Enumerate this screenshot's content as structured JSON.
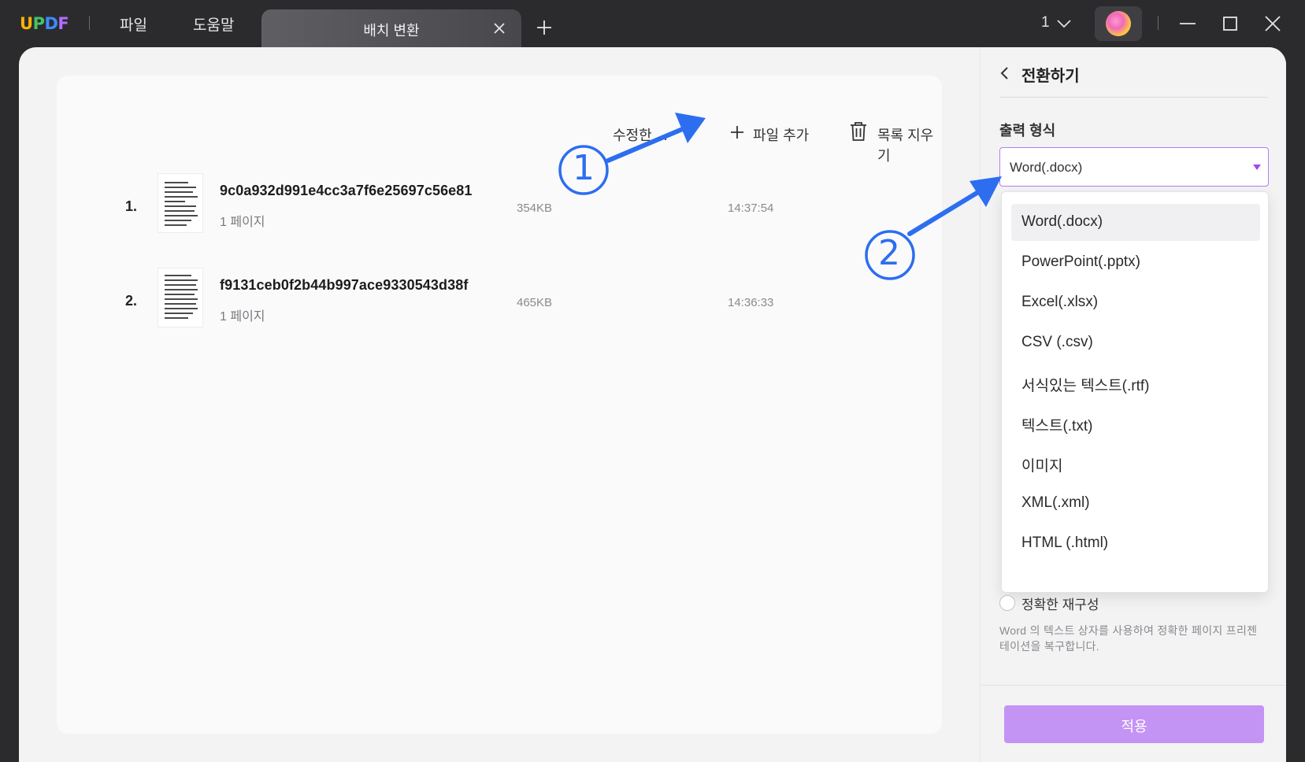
{
  "app": {
    "logo_letters": [
      "U",
      "P",
      "D",
      "F"
    ],
    "menu": [
      "파일",
      "도움말"
    ],
    "tab_title": "배치 변환",
    "window_count": "1"
  },
  "toolbar": {
    "sort_label": "수정한 ...",
    "add_file_label": "파일 추가",
    "clear_list_label": "목록 지우기"
  },
  "files": [
    {
      "index": "1.",
      "name": "9c0a932d991e4cc3a7f6e25697c56e81",
      "pages": "1 페이지",
      "size": "354KB",
      "time": "14:37:54"
    },
    {
      "index": "2.",
      "name": "f9131ceb0f2b44b997ace9330543d38f",
      "pages": "1 페이지",
      "size": "465KB",
      "time": "14:36:33"
    }
  ],
  "panel": {
    "title": "전환하기",
    "output_label": "출력 형식",
    "selected_format": "Word(.docx)",
    "format_options": [
      "Word(.docx)",
      "PowerPoint(.pptx)",
      "Excel(.xlsx)",
      "CSV (.csv)",
      "서식있는 텍스트(.rtf)",
      "텍스트(.txt)",
      "이미지",
      "XML(.xml)",
      "HTML (.html)"
    ],
    "radio_label": "정확한 재구성",
    "radio_desc": "Word 의 텍스트 상자를 사용하여 정확한 페이지 프리젠테이션을 복구합니다.",
    "apply_label": "적용"
  },
  "annotations": [
    "1",
    "2"
  ],
  "colors": {
    "titlebar_bg": "#2b2b2e",
    "accent_purple": "#b67cf0",
    "apply_button": "#c494f5",
    "annotation_blue": "#2d6ef0"
  }
}
